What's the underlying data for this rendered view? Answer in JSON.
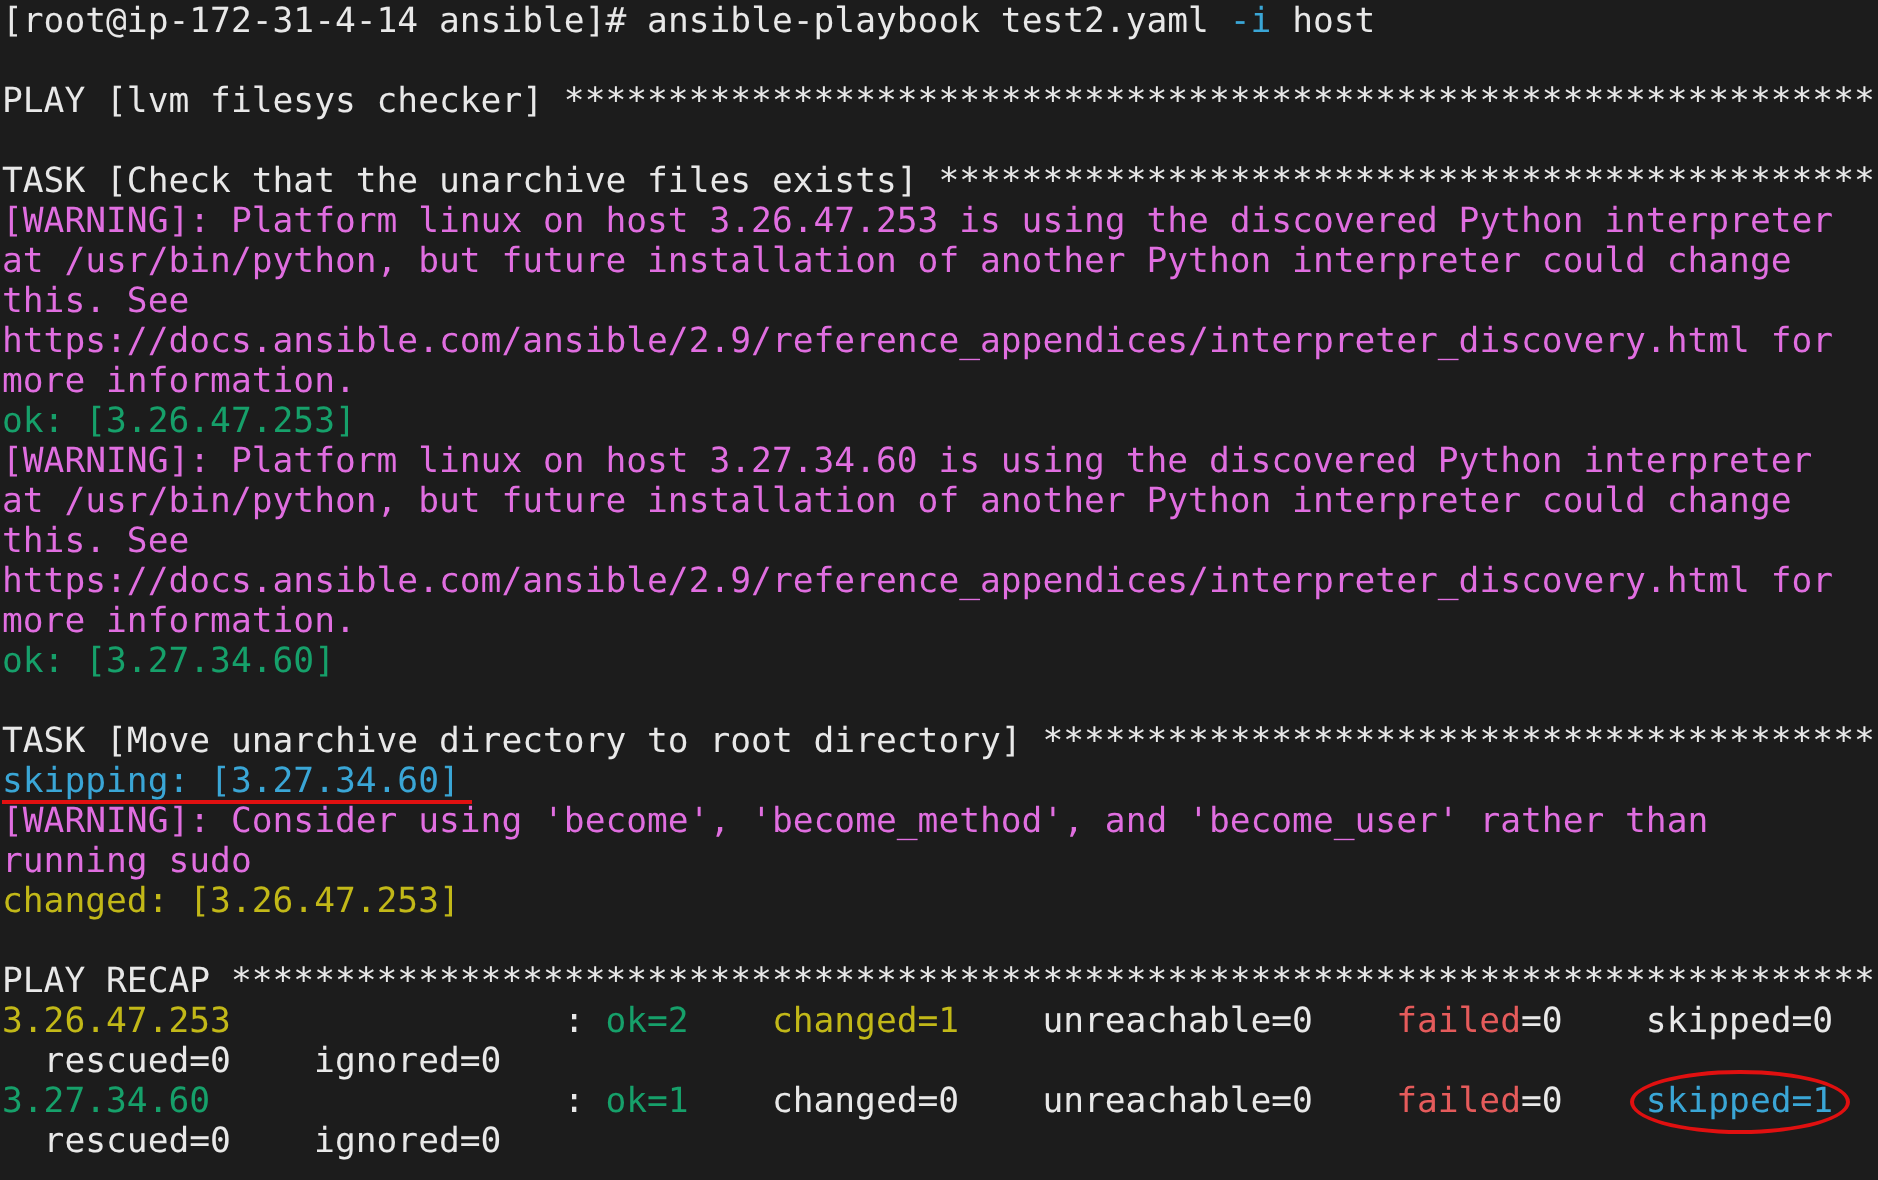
{
  "command": {
    "prompt": "[root@ip-172-31-4-14 ansible]#",
    "program": "ansible-playbook test2.yaml",
    "flag": "-i",
    "argument": "host"
  },
  "output": [
    {
      "kind": "blank"
    },
    {
      "kind": "header",
      "text": "PLAY [lvm filesys checker] ***************************************************************"
    },
    {
      "kind": "blank"
    },
    {
      "kind": "header",
      "text": "TASK [Check that the unarchive files exists] *********************************************"
    },
    {
      "kind": "warning",
      "text": "[WARNING]: Platform linux on host 3.26.47.253 is using the discovered Python interpreter"
    },
    {
      "kind": "warning",
      "text": "at /usr/bin/python, but future installation of another Python interpreter could change"
    },
    {
      "kind": "warning",
      "text": "this. See"
    },
    {
      "kind": "warning",
      "text": "https://docs.ansible.com/ansible/2.9/reference_appendices/interpreter_discovery.html for"
    },
    {
      "kind": "warning",
      "text": "more information."
    },
    {
      "kind": "ok",
      "text": "ok: [3.26.47.253]"
    },
    {
      "kind": "warning",
      "text": "[WARNING]: Platform linux on host 3.27.34.60 is using the discovered Python interpreter"
    },
    {
      "kind": "warning",
      "text": "at /usr/bin/python, but future installation of another Python interpreter could change"
    },
    {
      "kind": "warning",
      "text": "this. See"
    },
    {
      "kind": "warning",
      "text": "https://docs.ansible.com/ansible/2.9/reference_appendices/interpreter_discovery.html for"
    },
    {
      "kind": "warning",
      "text": "more information."
    },
    {
      "kind": "ok",
      "text": "ok: [3.27.34.60]"
    },
    {
      "kind": "blank"
    },
    {
      "kind": "header",
      "text": "TASK [Move unarchive directory to root directory] ****************************************"
    },
    {
      "kind": "skipping",
      "text": "skipping: [3.27.34.60]",
      "underlined": true
    },
    {
      "kind": "warning",
      "text": "[WARNING]: Consider using 'become', 'become_method', and 'become_user' rather than"
    },
    {
      "kind": "warning",
      "text": "running sudo"
    },
    {
      "kind": "changed",
      "text": "changed: [3.26.47.253]"
    },
    {
      "kind": "blank"
    },
    {
      "kind": "header",
      "text": "PLAY RECAP *******************************************************************************"
    }
  ],
  "recap": [
    {
      "host": "3.26.47.253",
      "color": "#c2b818",
      "separator": ":",
      "stats": [
        {
          "parts": [
            {
              "text": "ok=2",
              "color": "#16a06a"
            }
          ],
          "circled": false
        },
        {
          "parts": [
            {
              "text": "changed=1",
              "color": "#c2b818"
            }
          ],
          "circled": false
        },
        {
          "parts": [
            {
              "text": "unreachable=0",
              "color": "#e8e8e8"
            }
          ],
          "circled": false
        },
        {
          "parts": [
            {
              "text": "failed",
              "color": "#e55b5b"
            },
            {
              "text": "=0",
              "color": "#e8e8e8"
            }
          ],
          "circled": false
        },
        {
          "parts": [
            {
              "text": "skipped=0",
              "color": "#e8e8e8"
            }
          ],
          "circled": false
        }
      ],
      "more_stats": [
        "rescued=0",
        "ignored=0"
      ]
    },
    {
      "host": "3.27.34.60",
      "color": "#16a06a",
      "separator": ":",
      "stats": [
        {
          "parts": [
            {
              "text": "ok=1",
              "color": "#16a06a"
            }
          ],
          "circled": false
        },
        {
          "parts": [
            {
              "text": "changed=0",
              "color": "#e8e8e8"
            }
          ],
          "circled": false
        },
        {
          "parts": [
            {
              "text": "unreachable=0",
              "color": "#e8e8e8"
            }
          ],
          "circled": false
        },
        {
          "parts": [
            {
              "text": "failed",
              "color": "#e55b5b"
            },
            {
              "text": "=0",
              "color": "#e8e8e8"
            }
          ],
          "circled": false
        },
        {
          "parts": [
            {
              "text": "skipped=1",
              "color": "#3aa6d6"
            }
          ],
          "circled": true
        }
      ],
      "more_stats": [
        "rescued=0",
        "ignored=0"
      ]
    }
  ]
}
